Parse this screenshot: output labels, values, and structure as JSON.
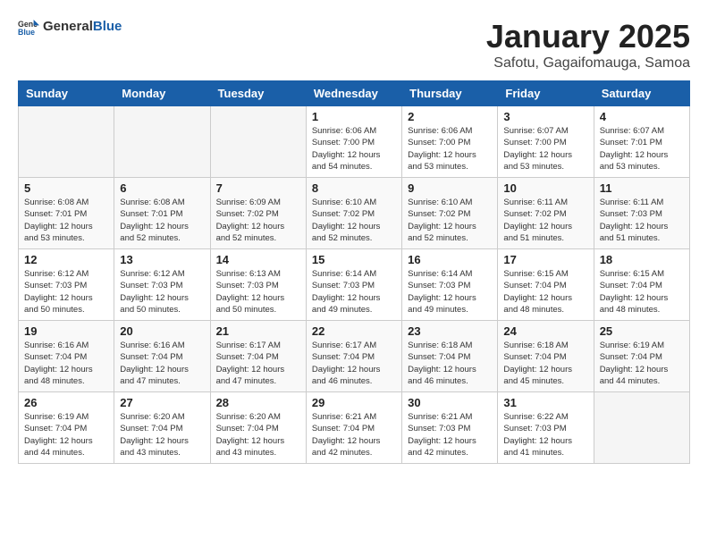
{
  "header": {
    "logo": {
      "general": "General",
      "blue": "Blue"
    },
    "title": "January 2025",
    "location": "Safotu, Gagaifomauga, Samoa"
  },
  "calendar": {
    "days_of_week": [
      "Sunday",
      "Monday",
      "Tuesday",
      "Wednesday",
      "Thursday",
      "Friday",
      "Saturday"
    ],
    "weeks": [
      [
        {
          "day": "",
          "info": ""
        },
        {
          "day": "",
          "info": ""
        },
        {
          "day": "",
          "info": ""
        },
        {
          "day": "1",
          "info": "Sunrise: 6:06 AM\nSunset: 7:00 PM\nDaylight: 12 hours\nand 54 minutes."
        },
        {
          "day": "2",
          "info": "Sunrise: 6:06 AM\nSunset: 7:00 PM\nDaylight: 12 hours\nand 53 minutes."
        },
        {
          "day": "3",
          "info": "Sunrise: 6:07 AM\nSunset: 7:00 PM\nDaylight: 12 hours\nand 53 minutes."
        },
        {
          "day": "4",
          "info": "Sunrise: 6:07 AM\nSunset: 7:01 PM\nDaylight: 12 hours\nand 53 minutes."
        }
      ],
      [
        {
          "day": "5",
          "info": "Sunrise: 6:08 AM\nSunset: 7:01 PM\nDaylight: 12 hours\nand 53 minutes."
        },
        {
          "day": "6",
          "info": "Sunrise: 6:08 AM\nSunset: 7:01 PM\nDaylight: 12 hours\nand 52 minutes."
        },
        {
          "day": "7",
          "info": "Sunrise: 6:09 AM\nSunset: 7:02 PM\nDaylight: 12 hours\nand 52 minutes."
        },
        {
          "day": "8",
          "info": "Sunrise: 6:10 AM\nSunset: 7:02 PM\nDaylight: 12 hours\nand 52 minutes."
        },
        {
          "day": "9",
          "info": "Sunrise: 6:10 AM\nSunset: 7:02 PM\nDaylight: 12 hours\nand 52 minutes."
        },
        {
          "day": "10",
          "info": "Sunrise: 6:11 AM\nSunset: 7:02 PM\nDaylight: 12 hours\nand 51 minutes."
        },
        {
          "day": "11",
          "info": "Sunrise: 6:11 AM\nSunset: 7:03 PM\nDaylight: 12 hours\nand 51 minutes."
        }
      ],
      [
        {
          "day": "12",
          "info": "Sunrise: 6:12 AM\nSunset: 7:03 PM\nDaylight: 12 hours\nand 50 minutes."
        },
        {
          "day": "13",
          "info": "Sunrise: 6:12 AM\nSunset: 7:03 PM\nDaylight: 12 hours\nand 50 minutes."
        },
        {
          "day": "14",
          "info": "Sunrise: 6:13 AM\nSunset: 7:03 PM\nDaylight: 12 hours\nand 50 minutes."
        },
        {
          "day": "15",
          "info": "Sunrise: 6:14 AM\nSunset: 7:03 PM\nDaylight: 12 hours\nand 49 minutes."
        },
        {
          "day": "16",
          "info": "Sunrise: 6:14 AM\nSunset: 7:03 PM\nDaylight: 12 hours\nand 49 minutes."
        },
        {
          "day": "17",
          "info": "Sunrise: 6:15 AM\nSunset: 7:04 PM\nDaylight: 12 hours\nand 48 minutes."
        },
        {
          "day": "18",
          "info": "Sunrise: 6:15 AM\nSunset: 7:04 PM\nDaylight: 12 hours\nand 48 minutes."
        }
      ],
      [
        {
          "day": "19",
          "info": "Sunrise: 6:16 AM\nSunset: 7:04 PM\nDaylight: 12 hours\nand 48 minutes."
        },
        {
          "day": "20",
          "info": "Sunrise: 6:16 AM\nSunset: 7:04 PM\nDaylight: 12 hours\nand 47 minutes."
        },
        {
          "day": "21",
          "info": "Sunrise: 6:17 AM\nSunset: 7:04 PM\nDaylight: 12 hours\nand 47 minutes."
        },
        {
          "day": "22",
          "info": "Sunrise: 6:17 AM\nSunset: 7:04 PM\nDaylight: 12 hours\nand 46 minutes."
        },
        {
          "day": "23",
          "info": "Sunrise: 6:18 AM\nSunset: 7:04 PM\nDaylight: 12 hours\nand 46 minutes."
        },
        {
          "day": "24",
          "info": "Sunrise: 6:18 AM\nSunset: 7:04 PM\nDaylight: 12 hours\nand 45 minutes."
        },
        {
          "day": "25",
          "info": "Sunrise: 6:19 AM\nSunset: 7:04 PM\nDaylight: 12 hours\nand 44 minutes."
        }
      ],
      [
        {
          "day": "26",
          "info": "Sunrise: 6:19 AM\nSunset: 7:04 PM\nDaylight: 12 hours\nand 44 minutes."
        },
        {
          "day": "27",
          "info": "Sunrise: 6:20 AM\nSunset: 7:04 PM\nDaylight: 12 hours\nand 43 minutes."
        },
        {
          "day": "28",
          "info": "Sunrise: 6:20 AM\nSunset: 7:04 PM\nDaylight: 12 hours\nand 43 minutes."
        },
        {
          "day": "29",
          "info": "Sunrise: 6:21 AM\nSunset: 7:04 PM\nDaylight: 12 hours\nand 42 minutes."
        },
        {
          "day": "30",
          "info": "Sunrise: 6:21 AM\nSunset: 7:03 PM\nDaylight: 12 hours\nand 42 minutes."
        },
        {
          "day": "31",
          "info": "Sunrise: 6:22 AM\nSunset: 7:03 PM\nDaylight: 12 hours\nand 41 minutes."
        },
        {
          "day": "",
          "info": ""
        }
      ]
    ]
  }
}
